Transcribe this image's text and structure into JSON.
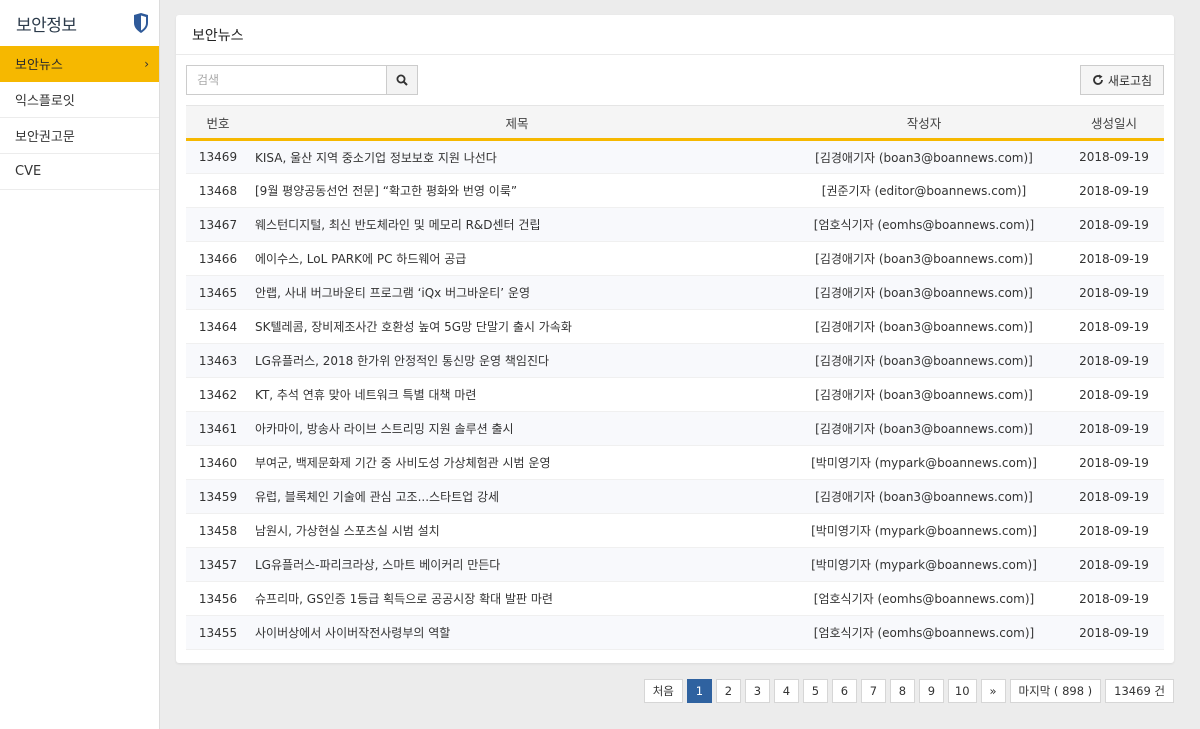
{
  "sidebar": {
    "title": "보안정보",
    "title_icon": "shield-icon",
    "items": [
      {
        "label": "보안뉴스",
        "active": true
      },
      {
        "label": "익스플로잇",
        "active": false
      },
      {
        "label": "보안권고문",
        "active": false
      },
      {
        "label": "CVE",
        "active": false
      }
    ]
  },
  "main": {
    "title": "보안뉴스",
    "search": {
      "placeholder": "검색",
      "value": ""
    },
    "refresh_label": "새로고침",
    "columns": {
      "num": "번호",
      "title": "제목",
      "author": "작성자",
      "date": "생성일시"
    },
    "rows": [
      {
        "num": "13469",
        "title": "KISA, 울산 지역 중소기업 정보보호 지원 나선다",
        "author": "[김경애기자 (boan3@boannews.com)]",
        "date": "2018-09-19"
      },
      {
        "num": "13468",
        "title": "[9월 평양공동선언 전문] “확고한 평화와 번영 이룩”",
        "author": "[권준기자 (editor@boannews.com)]",
        "date": "2018-09-19"
      },
      {
        "num": "13467",
        "title": "웨스턴디지털, 최신 반도체라인 및 메모리 R&D센터 건립",
        "author": "[엄호식기자 (eomhs@boannews.com)]",
        "date": "2018-09-19"
      },
      {
        "num": "13466",
        "title": "에이수스, LoL PARK에 PC 하드웨어 공급",
        "author": "[김경애기자 (boan3@boannews.com)]",
        "date": "2018-09-19"
      },
      {
        "num": "13465",
        "title": "안랩, 사내 버그바운티 프로그램 ‘iQx 버그바운티’ 운영",
        "author": "[김경애기자 (boan3@boannews.com)]",
        "date": "2018-09-19"
      },
      {
        "num": "13464",
        "title": "SK텔레콤, 장비제조사간 호환성 높여 5G망 단말기 출시 가속화",
        "author": "[김경애기자 (boan3@boannews.com)]",
        "date": "2018-09-19"
      },
      {
        "num": "13463",
        "title": "LG유플러스, 2018 한가위 안정적인 통신망 운영 책임진다",
        "author": "[김경애기자 (boan3@boannews.com)]",
        "date": "2018-09-19"
      },
      {
        "num": "13462",
        "title": "KT, 추석 연휴 맞아 네트워크 특별 대책 마련",
        "author": "[김경애기자 (boan3@boannews.com)]",
        "date": "2018-09-19"
      },
      {
        "num": "13461",
        "title": "아카마이, 방송사 라이브 스트리밍 지원 솔루션 출시",
        "author": "[김경애기자 (boan3@boannews.com)]",
        "date": "2018-09-19"
      },
      {
        "num": "13460",
        "title": "부여군, 백제문화제 기간 중 사비도성 가상체험관 시범 운영",
        "author": "[박미영기자 (mypark@boannews.com)]",
        "date": "2018-09-19"
      },
      {
        "num": "13459",
        "title": "유럽, 블록체인 기술에 관심 고조...스타트업 강세",
        "author": "[김경애기자 (boan3@boannews.com)]",
        "date": "2018-09-19"
      },
      {
        "num": "13458",
        "title": "남원시, 가상현실 스포츠실 시범 설치",
        "author": "[박미영기자 (mypark@boannews.com)]",
        "date": "2018-09-19"
      },
      {
        "num": "13457",
        "title": "LG유플러스-파리크라상, 스마트 베이커리 만든다",
        "author": "[박미영기자 (mypark@boannews.com)]",
        "date": "2018-09-19"
      },
      {
        "num": "13456",
        "title": "슈프리마, GS인증 1등급 획득으로 공공시장 확대 발판 마련",
        "author": "[엄호식기자 (eomhs@boannews.com)]",
        "date": "2018-09-19"
      },
      {
        "num": "13455",
        "title": "사이버상에서 사이버작전사령부의 역할",
        "author": "[엄호식기자 (eomhs@boannews.com)]",
        "date": "2018-09-19"
      }
    ]
  },
  "pagination": {
    "first_label": "처음",
    "pages": [
      "1",
      "2",
      "3",
      "4",
      "5",
      "6",
      "7",
      "8",
      "9",
      "10"
    ],
    "current_page": "1",
    "next_label": "»",
    "last_label": "마지막 ( 898 )",
    "total_label": "13469 건"
  },
  "colors": {
    "accent": "#f6b800",
    "active_page": "#2f62a0",
    "shield": "#2f5a99"
  }
}
